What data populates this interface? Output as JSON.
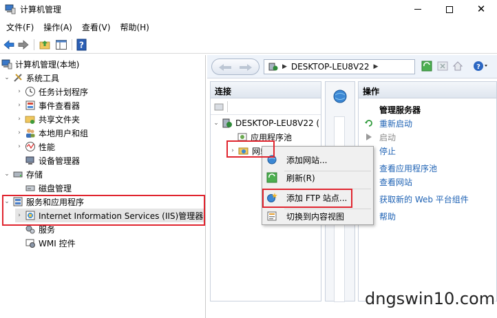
{
  "window": {
    "title": "计算机管理",
    "minimize_symbol": "",
    "close_symbol": "✕"
  },
  "menu": [
    "文件(F)",
    "操作(A)",
    "查看(V)",
    "帮助(H)"
  ],
  "toolbar": {
    "help_glyph": "?"
  },
  "tree": {
    "root": "计算机管理(本地)",
    "system_tools": "系统工具",
    "task_scheduler": "任务计划程序",
    "event_viewer": "事件查看器",
    "shared_folders": "共享文件夹",
    "local_users": "本地用户和组",
    "performance": "性能",
    "device_manager": "设备管理器",
    "storage": "存储",
    "disk_management": "磁盘管理",
    "services_apps": "服务和应用程序",
    "iis": "Internet Information Services (IIS)管理器",
    "services": "服务",
    "wmi": "WMI 控件"
  },
  "nav": {
    "address": "DESKTOP-LEU8V22",
    "help_glyph": "?"
  },
  "connections": {
    "header": "连接",
    "server": "DESKTOP-LEU8V22 (",
    "app_pools": "应用程序池",
    "sites": "网站"
  },
  "actions": {
    "header": "操作",
    "section": "管理服务器",
    "items": [
      {
        "label": "重新启动",
        "enabled": true
      },
      {
        "label": "启动",
        "enabled": false
      },
      {
        "label": "停止",
        "enabled": true
      },
      {
        "label": "查看应用程序池",
        "enabled": true
      },
      {
        "label": "查看网站",
        "enabled": true
      },
      {
        "label": "获取新的 Web 平台组件",
        "enabled": true
      },
      {
        "label": "帮助",
        "enabled": true
      }
    ]
  },
  "context_menu": {
    "add_site": "添加网站...",
    "refresh": "刷新(R)",
    "add_ftp": "添加 FTP 站点...",
    "switch_content": "切换到内容视图"
  },
  "watermark": "dngswin10.com",
  "colors": {
    "highlight_box": "#e0242e",
    "link": "#1e62b4"
  }
}
